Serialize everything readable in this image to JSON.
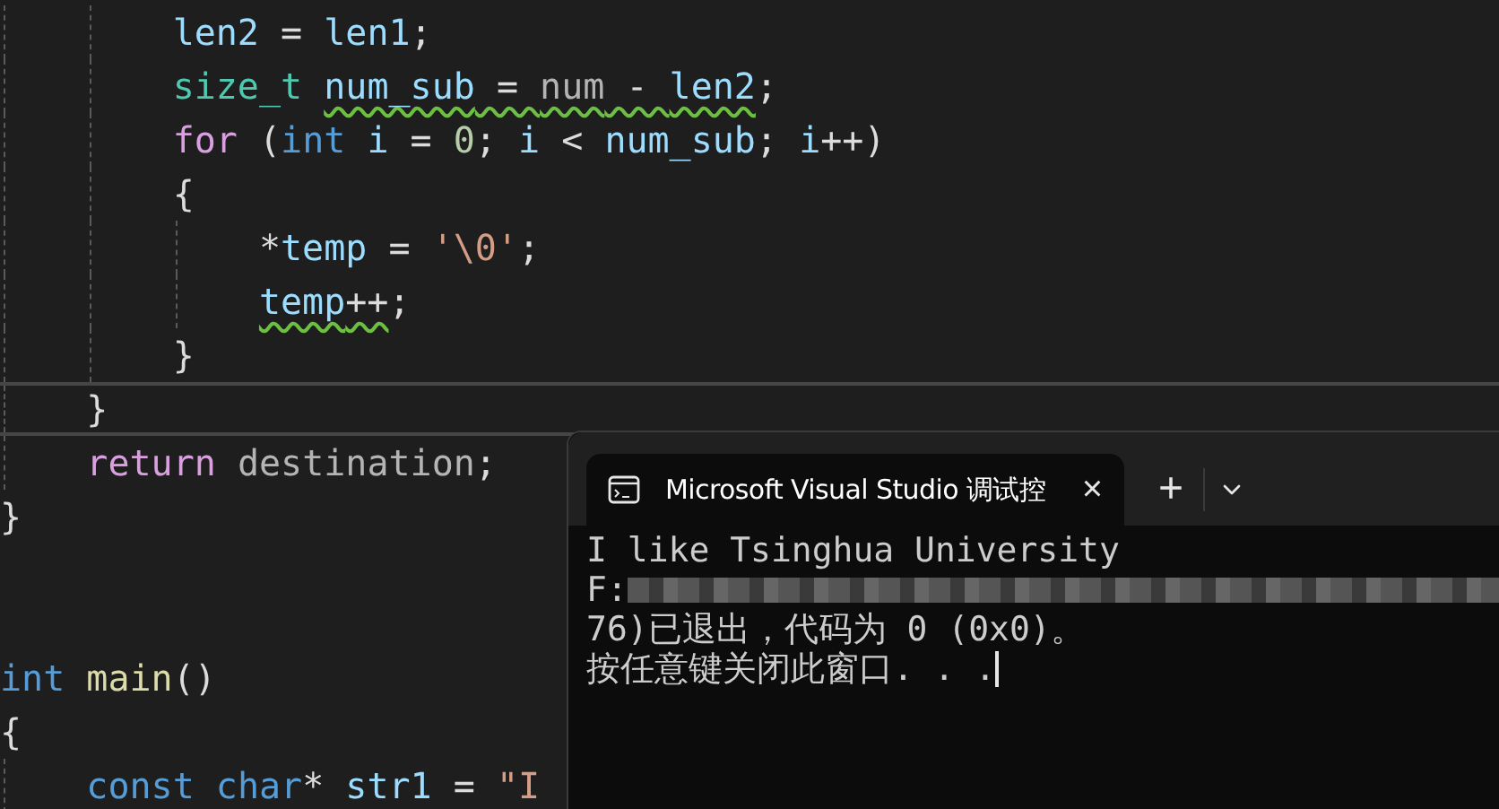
{
  "editor": {
    "lines": [
      {
        "children": [
          {
            "children": [
              {
                "current": false,
                "tokens": [
                  {
                    "text": "len2",
                    "kind": "var",
                    "squiggle": false
                  },
                  {
                    "text": " = ",
                    "kind": "plain",
                    "squiggle": false
                  },
                  {
                    "text": "len1",
                    "kind": "var",
                    "squiggle": false
                  },
                  {
                    "text": ";",
                    "kind": "plain",
                    "squiggle": false
                  }
                ]
              },
              {
                "current": false,
                "tokens": [
                  {
                    "text": "size_t ",
                    "kind": "typedef",
                    "squiggle": false
                  },
                  {
                    "text": "num_sub",
                    "kind": "var",
                    "squiggle": true
                  },
                  {
                    "text": " = ",
                    "kind": "plain",
                    "squiggle": true
                  },
                  {
                    "text": "num",
                    "kind": "param",
                    "squiggle": true
                  },
                  {
                    "text": " - ",
                    "kind": "plain",
                    "squiggle": true
                  },
                  {
                    "text": "len2",
                    "kind": "var",
                    "squiggle": true
                  },
                  {
                    "text": ";",
                    "kind": "plain",
                    "squiggle": false
                  }
                ]
              },
              {
                "current": false,
                "tokens": [
                  {
                    "text": "for",
                    "kind": "control",
                    "squiggle": false
                  },
                  {
                    "text": " (",
                    "kind": "plain",
                    "squiggle": false
                  },
                  {
                    "text": "int",
                    "kind": "keyword",
                    "squiggle": false
                  },
                  {
                    "text": " i",
                    "kind": "var",
                    "squiggle": false
                  },
                  {
                    "text": " = ",
                    "kind": "plain",
                    "squiggle": false
                  },
                  {
                    "text": "0",
                    "kind": "number",
                    "squiggle": false
                  },
                  {
                    "text": "; ",
                    "kind": "plain",
                    "squiggle": false
                  },
                  {
                    "text": "i",
                    "kind": "var",
                    "squiggle": false
                  },
                  {
                    "text": " < ",
                    "kind": "plain",
                    "squiggle": false
                  },
                  {
                    "text": "num_sub",
                    "kind": "var",
                    "squiggle": false
                  },
                  {
                    "text": "; ",
                    "kind": "plain",
                    "squiggle": false
                  },
                  {
                    "text": "i",
                    "kind": "var",
                    "squiggle": false
                  },
                  {
                    "text": "++)",
                    "kind": "plain",
                    "squiggle": false
                  }
                ]
              },
              {
                "current": false,
                "tokens": [
                  {
                    "text": "{",
                    "kind": "plain",
                    "squiggle": false
                  }
                ]
              },
              {
                "children": [
                  {
                    "current": false,
                    "tokens": [
                      {
                        "text": "*",
                        "kind": "plain",
                        "squiggle": false
                      },
                      {
                        "text": "temp",
                        "kind": "var",
                        "squiggle": false
                      },
                      {
                        "text": " = ",
                        "kind": "plain",
                        "squiggle": false
                      },
                      {
                        "text": "'\\0'",
                        "kind": "string",
                        "squiggle": false
                      },
                      {
                        "text": ";",
                        "kind": "plain",
                        "squiggle": false
                      }
                    ]
                  },
                  {
                    "current": false,
                    "tokens": [
                      {
                        "text": "temp",
                        "kind": "var",
                        "squiggle": true
                      },
                      {
                        "text": "++",
                        "kind": "plain",
                        "squiggle": true
                      },
                      {
                        "text": ";",
                        "kind": "plain",
                        "squiggle": false
                      }
                    ]
                  }
                ]
              },
              {
                "current": false,
                "tokens": [
                  {
                    "text": "}",
                    "kind": "plain",
                    "squiggle": false
                  }
                ]
              }
            ]
          },
          {
            "current": true,
            "tokens": [
              {
                "text": "}",
                "kind": "plain",
                "squiggle": false
              }
            ]
          },
          {
            "current": false,
            "tokens": [
              {
                "text": "return ",
                "kind": "control",
                "squiggle": false
              },
              {
                "text": "destination",
                "kind": "param",
                "squiggle": false
              },
              {
                "text": ";",
                "kind": "plain",
                "squiggle": false
              }
            ]
          }
        ]
      },
      {
        "current": false,
        "tokens": [
          {
            "text": "}",
            "kind": "plain",
            "squiggle": false
          }
        ]
      },
      {
        "current": false
      },
      {
        "current": false
      },
      {
        "current": false,
        "tokens": [
          {
            "text": "int ",
            "kind": "keyword",
            "squiggle": false
          },
          {
            "text": "main",
            "kind": "function",
            "squiggle": false
          },
          {
            "text": "()",
            "kind": "plain",
            "squiggle": false
          }
        ]
      },
      {
        "current": false,
        "tokens": [
          {
            "text": "{",
            "kind": "plain",
            "squiggle": false
          }
        ]
      },
      {
        "children": [
          {
            "current": false,
            "tokens": [
              {
                "text": "const ",
                "kind": "keyword",
                "squiggle": false
              },
              {
                "text": "char",
                "kind": "keyword",
                "squiggle": false
              },
              {
                "text": "* ",
                "kind": "plain",
                "squiggle": false
              },
              {
                "text": "str1",
                "kind": "var",
                "squiggle": false
              },
              {
                "text": " = ",
                "kind": "plain",
                "squiggle": false
              },
              {
                "text": "\"I",
                "kind": "string",
                "squiggle": false
              }
            ]
          }
        ]
      }
    ]
  },
  "terminal": {
    "tab": {
      "title": "Microsoft Visual Studio 调试控",
      "close": "×"
    },
    "new_tab": "+",
    "output": [
      {
        "text": "I like Tsinghua University",
        "kind": "plain"
      },
      {
        "text": "F:",
        "kind": "redacted"
      },
      {
        "text": "76)已退出，代码为 0 (0x0)。",
        "kind": "plain"
      },
      {
        "text": "按任意键关闭此窗口. . .",
        "kind": "cursor"
      }
    ]
  }
}
